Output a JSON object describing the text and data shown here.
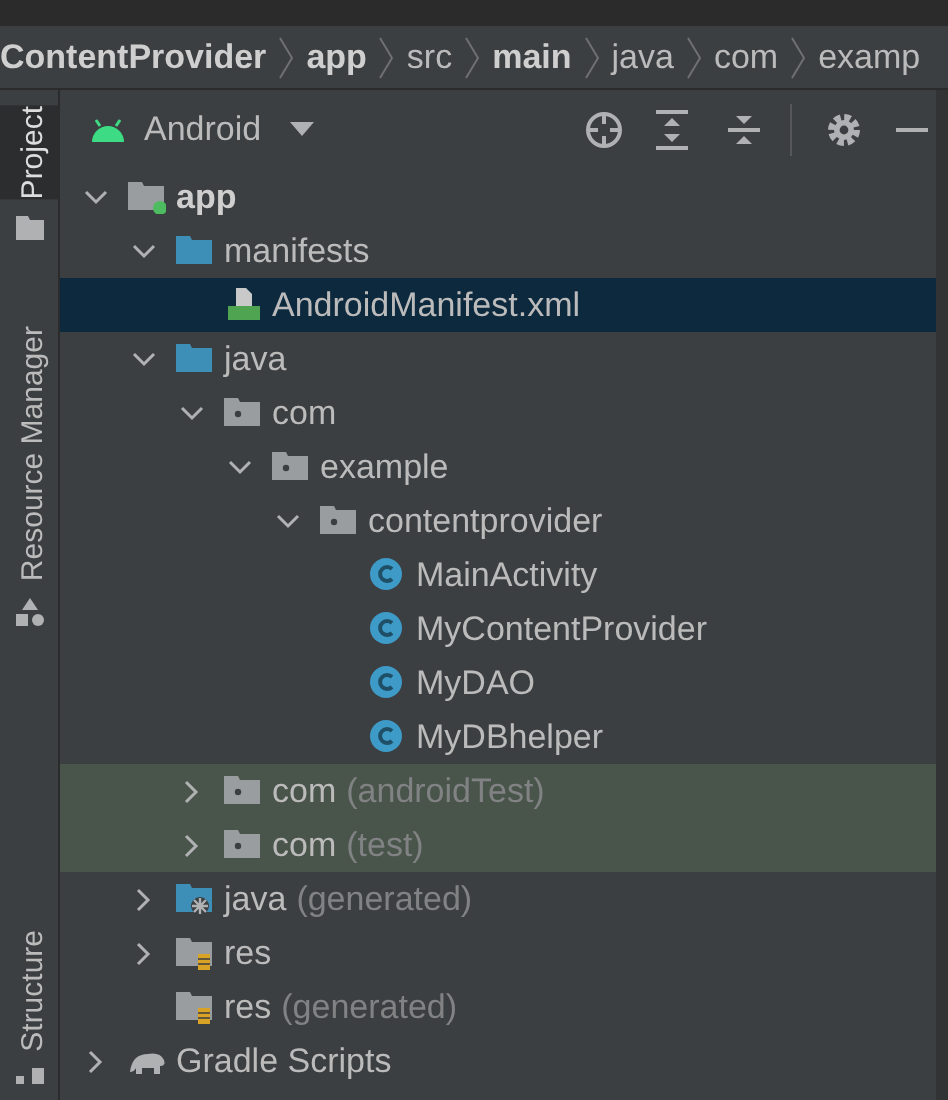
{
  "breadcrumb": [
    {
      "label": "ContentProvider",
      "bold": true
    },
    {
      "label": "app",
      "bold": true
    },
    {
      "label": "src",
      "bold": false
    },
    {
      "label": "main",
      "bold": true
    },
    {
      "label": "java",
      "bold": false
    },
    {
      "label": "com",
      "bold": false
    },
    {
      "label": "examp",
      "bold": false
    }
  ],
  "side_tabs": [
    {
      "label": "Project",
      "selected": true
    },
    {
      "label": "Resource Manager",
      "selected": false
    },
    {
      "label": "Structure",
      "selected": false
    }
  ],
  "view_selector": {
    "label": "Android"
  },
  "tree": [
    {
      "kind": "module",
      "label": "app",
      "bold": true,
      "expanded": true,
      "selected": false,
      "children": [
        {
          "kind": "folder",
          "label": "manifests",
          "expanded": true,
          "selected": false,
          "children": [
            {
              "kind": "manifest",
              "label": "AndroidManifest.xml",
              "selected": true
            }
          ]
        },
        {
          "kind": "folder",
          "label": "java",
          "expanded": true,
          "selected": false,
          "children": [
            {
              "kind": "package",
              "label": "com",
              "expanded": true,
              "selected": false,
              "children": [
                {
                  "kind": "package",
                  "label": "example",
                  "expanded": true,
                  "selected": false,
                  "children": [
                    {
                      "kind": "package",
                      "label": "contentprovider",
                      "expanded": true,
                      "selected": false,
                      "children": [
                        {
                          "kind": "class",
                          "label": "MainActivity",
                          "selected": false
                        },
                        {
                          "kind": "class",
                          "label": "MyContentProvider",
                          "selected": false
                        },
                        {
                          "kind": "class",
                          "label": "MyDAO",
                          "selected": false
                        },
                        {
                          "kind": "class",
                          "label": "MyDBhelper",
                          "selected": false
                        }
                      ]
                    }
                  ]
                }
              ]
            },
            {
              "kind": "package",
              "label": "com",
              "suffix": "(androidTest)",
              "test_scope": true,
              "expanded": false,
              "selected": false
            },
            {
              "kind": "package",
              "label": "com",
              "suffix": "(test)",
              "test_scope": true,
              "expanded": false,
              "selected": false
            }
          ]
        },
        {
          "kind": "generated",
          "label": "java",
          "suffix": "(generated)",
          "expanded": false,
          "selected": false
        },
        {
          "kind": "res",
          "label": "res",
          "expanded": false,
          "selected": false
        },
        {
          "kind": "res",
          "label": "res",
          "suffix": "(generated)",
          "selected": false
        }
      ]
    },
    {
      "kind": "gradle",
      "label": "Gradle Scripts",
      "expanded": false,
      "selected": false
    }
  ]
}
